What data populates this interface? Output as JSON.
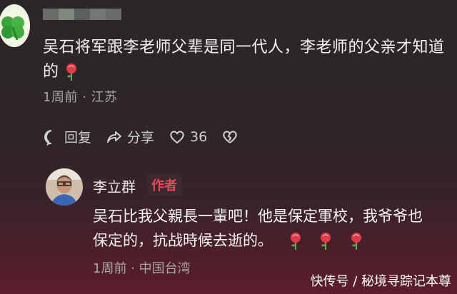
{
  "comment": {
    "text_line1": "吴石将军跟李老师父辈是同一代人，李老师的父亲才知道",
    "text_line2": "的",
    "time": "1周前",
    "separator": "·",
    "location": "江苏",
    "reply_label": "回复",
    "share_label": "分享",
    "like_count": "36"
  },
  "reply": {
    "author": "李立群",
    "badge": "作者",
    "text_line1": "吴石比我父親長一輩吧！他是保定軍校，我爷爷也",
    "text_line2": "保定的，抗战時候去逝的。",
    "time": "1周前",
    "separator": "·",
    "location": "中国台湾"
  },
  "watermark": "快传号 / 秘境寻踪记本尊",
  "colors": {
    "badge_red": "#f0445a",
    "rose_red": "#e23b48"
  },
  "icons": [
    "clover-icon",
    "reply-icon",
    "share-icon",
    "heart-icon",
    "broken-heart-icon",
    "rose-icon"
  ]
}
